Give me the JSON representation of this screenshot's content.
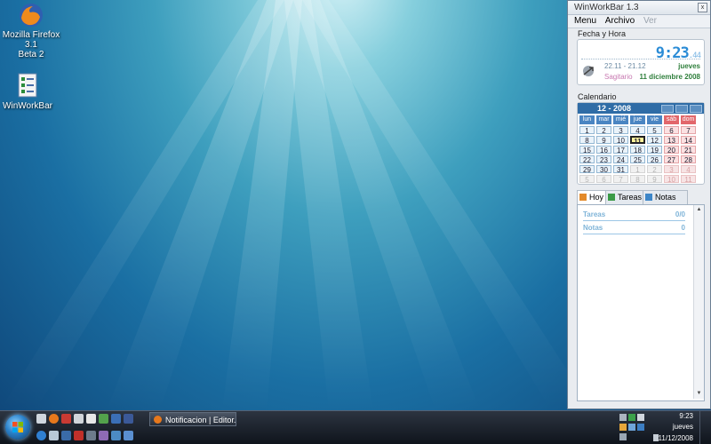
{
  "desktop": {
    "icons": [
      {
        "label_line1": "Mozilla Firefox 3.1",
        "label_line2": "Beta 2"
      },
      {
        "label_line1": "WinWorkBar",
        "label_line2": ""
      }
    ]
  },
  "widget": {
    "title": "WinWorkBar 1.3",
    "close": "x",
    "menu": [
      "Menu",
      "Archivo",
      "Ver"
    ],
    "fecha_group": "Fecha y Hora",
    "time": "9:23",
    "seconds": ".44",
    "zodiac_range": "22.11 - 21.12",
    "weekday": "jueves",
    "zodiac": "Sagitario",
    "date": "11 diciembre 2008",
    "calendar_group": "Calendario",
    "calendar_title": "12 - 2008",
    "day_headers": [
      "lun",
      "mar",
      "mié",
      "jue",
      "vie",
      "sáb",
      "dom"
    ],
    "weeks": [
      [
        "1",
        "2",
        "3",
        "4",
        "5",
        "6",
        "7"
      ],
      [
        "8",
        "9",
        "10",
        "11",
        "12",
        "13",
        "14"
      ],
      [
        "15",
        "16",
        "17",
        "18",
        "19",
        "20",
        "21"
      ],
      [
        "22",
        "23",
        "24",
        "25",
        "26",
        "27",
        "28"
      ],
      [
        "29",
        "30",
        "31",
        "1",
        "2",
        "3",
        "4"
      ],
      [
        "5",
        "6",
        "7",
        "8",
        "9",
        "10",
        "11"
      ]
    ],
    "tabs": [
      "Hoy",
      "Tareas",
      "Notas"
    ],
    "rows": [
      {
        "label": "Tareas",
        "count": "0/0"
      },
      {
        "label": "Notas",
        "count": "0"
      }
    ]
  },
  "taskbar": {
    "task_label": "Notificacion | Editor...",
    "time": "9:23",
    "weekday": "jueves",
    "date": "11/12/2008"
  }
}
